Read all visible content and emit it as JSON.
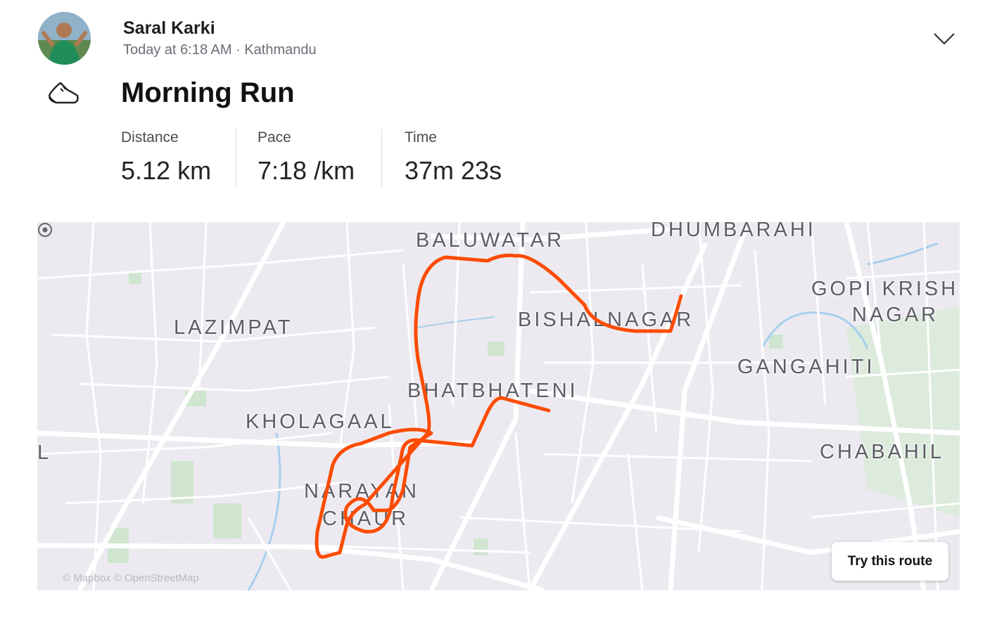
{
  "athlete": {
    "name": "Saral Karki",
    "meta": "Today at 6:18 AM · Kathmandu"
  },
  "activity": {
    "icon": "running-shoe-icon",
    "title": "Morning Run"
  },
  "stats": [
    {
      "label": "Distance",
      "value": "5.12 km"
    },
    {
      "label": "Pace",
      "value": "7:18 /km"
    },
    {
      "label": "Time",
      "value": "37m 23s"
    }
  ],
  "map": {
    "route_color": "#fc4c02",
    "places": [
      "BALUWATAR",
      "DHUMBARAHI",
      "GOPI KRISHNA",
      "NAGAR",
      "LAZIMPAT",
      "BISHALNAGAR",
      "GANGAHITI",
      "BHATBHATENI",
      "KHOLAGAAL",
      "CHABAHIL",
      "NARAYAN",
      "CHAUR",
      "L"
    ],
    "attribution": "© Mapbox © OpenStreetMap",
    "try_route_label": "Try this route"
  }
}
